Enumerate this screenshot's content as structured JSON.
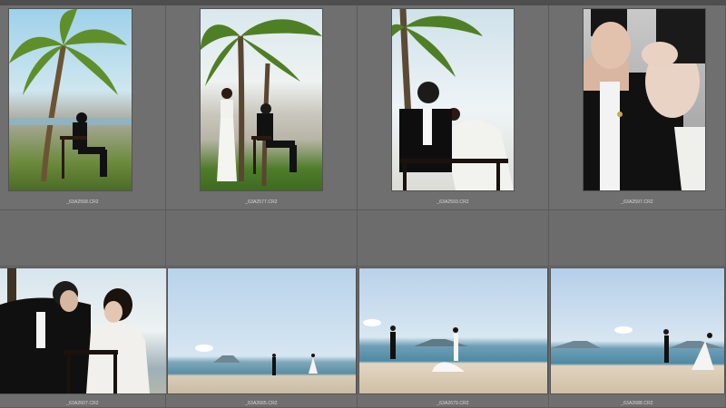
{
  "grid": {
    "thumbnails": [
      {
        "filename": "_63A2568.CR2",
        "scene": "palm-tree-seated-groom"
      },
      {
        "filename": "_63A2577.CR2",
        "scene": "palm-tree-couple"
      },
      {
        "filename": "_63A2593.CR2",
        "scene": "couple-chair-leaning"
      },
      {
        "filename": "_63A2597.CR2",
        "scene": "couple-closeup"
      },
      {
        "filename": "_63A2607.CR2",
        "scene": "couple-seated-shadow"
      },
      {
        "filename": "_63A2665.CR2",
        "scene": "beach-walk-far"
      },
      {
        "filename": "_63A2679.CR2",
        "scene": "beach-walk-mid"
      },
      {
        "filename": "_63A2688.CR2",
        "scene": "beach-walk-right"
      }
    ]
  },
  "colors": {
    "background": "#6a6a6a",
    "cell": "#6f6f6f",
    "caption": "#dcdcdc"
  }
}
